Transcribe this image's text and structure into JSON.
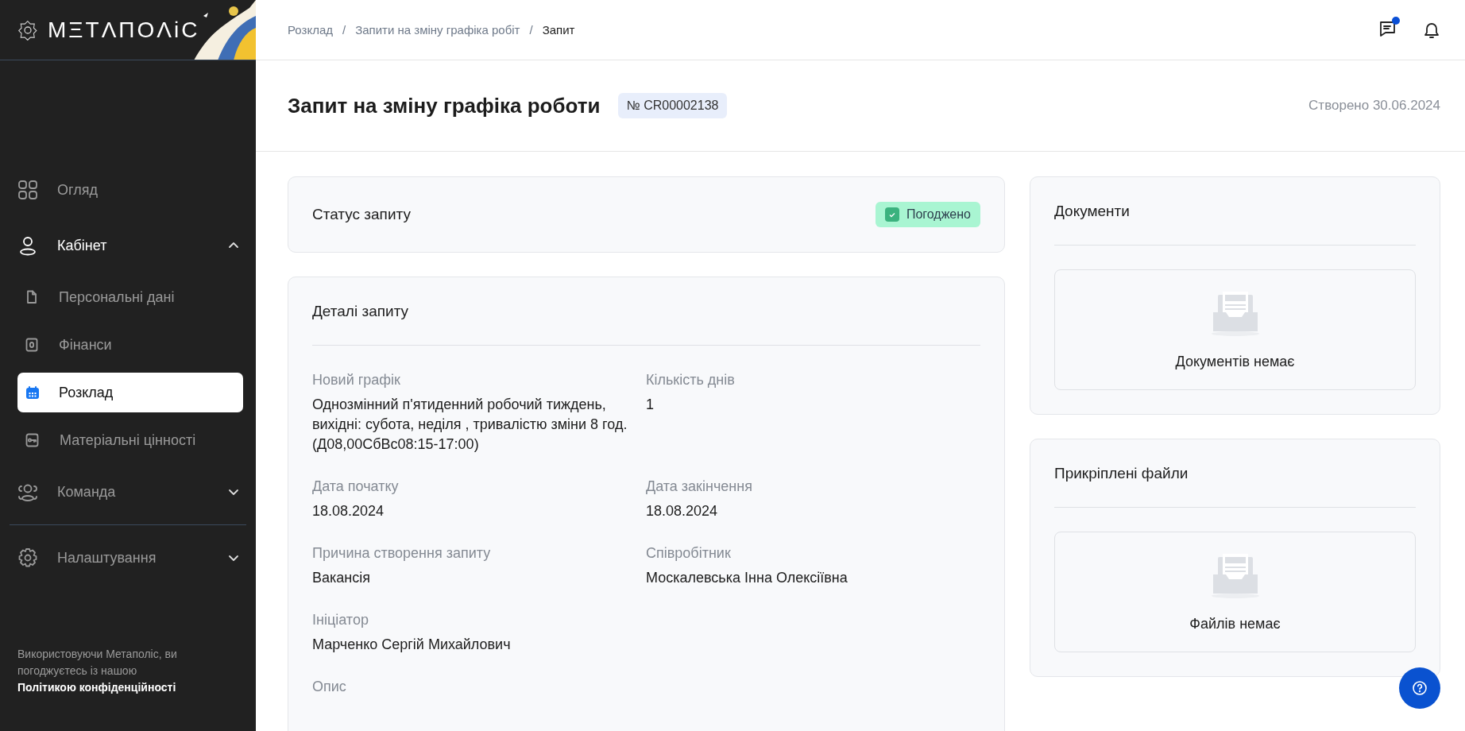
{
  "sidebar": {
    "logo": "МΞТΛПОΛіС",
    "items": [
      {
        "label": "Огляд",
        "kind": "link",
        "selected": false
      },
      {
        "label": "Кабінет",
        "kind": "group",
        "expanded": true,
        "children": [
          {
            "label": "Персональні дані",
            "selected": false
          },
          {
            "label": "Фінанси",
            "selected": false
          },
          {
            "label": "Розклад",
            "selected": true
          },
          {
            "label": "Матеріальні цінності",
            "selected": false
          }
        ]
      },
      {
        "label": "Команда",
        "kind": "group",
        "expanded": false
      },
      {
        "label": "Налаштування",
        "kind": "group",
        "expanded": false
      }
    ],
    "footer": {
      "text": "Використовуючи Метаполіс, ви погоджуєтесь із нашою",
      "link": "Політикою конфіденційності"
    }
  },
  "header": {
    "breadcrumbs": [
      {
        "label": "Розклад",
        "current": false
      },
      {
        "label": "Запити на зміну графіка робіт",
        "current": false
      },
      {
        "label": "Запит",
        "current": true
      }
    ],
    "separator": "/",
    "messages_unread": true
  },
  "page": {
    "title": "Запит на зміну графіка роботи",
    "number": "№ CR00002138",
    "created": "Створено 30.06.2024"
  },
  "status_card": {
    "title": "Статус запиту",
    "status": {
      "label": "Погоджено",
      "kind": "approved"
    }
  },
  "details": {
    "title": "Деталі запиту",
    "rows": [
      [
        {
          "label": "Новий графік",
          "value": "Однозмінний п'ятиденний робочий тиждень, вихідні: субота, неділя , тривалістю зміни 8 год. (Д08,00СбВс08:15-17:00)"
        },
        {
          "label": "Кількість днів",
          "value": "1"
        }
      ],
      [
        {
          "label": "Дата початку",
          "value": "18.08.2024"
        },
        {
          "label": "Дата закінчення",
          "value": "18.08.2024"
        }
      ],
      [
        {
          "label": "Причина створення запиту",
          "value": "Вакансія"
        },
        {
          "label": "Співробітник",
          "value": "Москалевська Інна Олексіївна"
        }
      ],
      [
        {
          "label": "Ініціатор",
          "value": "Марченко Сергій Михайлович"
        }
      ],
      [
        {
          "label": "Опис"
        }
      ]
    ]
  },
  "documents": {
    "title": "Документи",
    "empty": "Документів немає"
  },
  "attachments": {
    "title": "Прикріплені файли",
    "empty": "Файлів немає"
  }
}
